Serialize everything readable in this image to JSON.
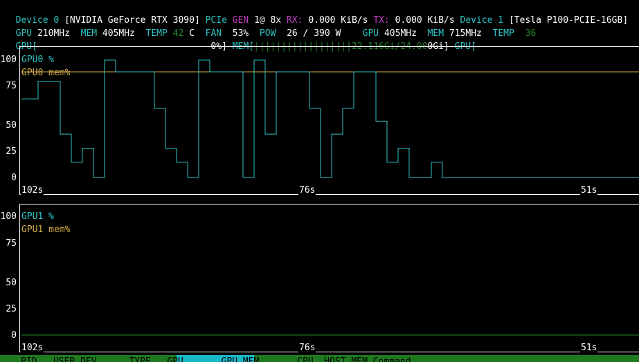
{
  "header": {
    "line1": {
      "dev0_label": "Device 0",
      "dev0_name": "[NVIDIA GeForce RTX 3090]",
      "pcie_label": "PCIe",
      "gen_label": "GEN",
      "gen_value": "1@",
      "width_value": "8x",
      "rx_label": "RX:",
      "rx_value": "0.000 KiB/s",
      "tx_label": "TX:",
      "tx_value": "0.000 KiB/s",
      "dev1_label": "Device 1",
      "dev1_name": "[Tesla P100-PCIE-16GB]"
    },
    "line2": {
      "gpu_label": "GPU",
      "gpu_value": "210MHz",
      "mem_label": "MEM",
      "mem_value": "405MHz",
      "temp_label": "TEMP",
      "temp_value": "42",
      "temp_unit": "C",
      "fan_label": "FAN",
      "fan_value": "53%",
      "pow_label": "POW",
      "pow_value": "26 / 390 W",
      "dev1_gpu_label": "GPU",
      "dev1_gpu_value": "405MHz",
      "dev1_mem_label": "MEM",
      "dev1_mem_value": "715MHz",
      "dev1_temp_label": "TEMP",
      "dev1_temp_value": "36"
    },
    "line3": {
      "gpu_bar_open": "GPU[",
      "gpu_bar_close": "0%]",
      "mem_bar_open": "MEM[",
      "mem_bar_fill": "||||||||||||||||||22.116Gi/24.00",
      "mem_bar_close": "0Gi]",
      "dev1_gpu_bar_open": "GPU["
    }
  },
  "charts": [
    {
      "series1_label": "GPU0 %",
      "series2_label": "GPU0 mem%",
      "yticks": [
        "100",
        "75",
        "50",
        "25",
        "0"
      ],
      "xticks": [
        "102s",
        "76s",
        "51s"
      ]
    },
    {
      "series1_label": "GPU1 %",
      "series2_label": "GPU1 mem%",
      "yticks": [
        "100",
        "75",
        "50",
        "25",
        "0"
      ],
      "xticks": [
        "102s",
        "76s",
        "51s"
      ]
    }
  ],
  "chart_data": [
    {
      "type": "line",
      "ylim": [
        0,
        100
      ],
      "series": [
        {
          "name": "GPU0 %",
          "color": "#2ec4c4",
          "step_values": [
            67,
            67,
            67,
            82,
            82,
            82,
            82,
            37,
            37,
            13,
            13,
            25,
            25,
            0,
            0,
            100,
            100,
            90,
            90,
            90,
            90,
            90,
            90,
            90,
            59,
            59,
            25,
            25,
            13,
            13,
            0,
            0,
            100,
            100,
            90,
            90,
            90,
            90,
            90,
            90,
            0,
            0,
            100,
            100,
            37,
            37,
            90,
            90,
            90,
            90,
            90,
            90,
            59,
            59,
            0,
            0,
            37,
            37,
            59,
            59,
            90,
            90,
            90,
            90,
            48,
            48,
            13,
            13,
            25,
            25,
            0,
            0,
            0,
            0,
            13,
            13,
            0,
            0,
            0,
            0,
            0,
            0,
            0,
            0,
            0,
            0,
            0,
            0,
            0,
            0,
            0,
            0,
            0,
            0,
            0,
            0,
            0,
            0,
            0,
            0,
            0,
            0,
            0,
            0,
            0,
            0,
            0,
            0,
            0,
            0,
            0,
            0
          ]
        },
        {
          "name": "GPU0 mem%",
          "color": "#d6b24a",
          "value": 90
        }
      ]
    },
    {
      "type": "line",
      "ylim": [
        0,
        100
      ],
      "series": [
        {
          "name": "GPU1 %",
          "color": "#2ec4c4",
          "value": 0
        },
        {
          "name": "GPU1 mem%",
          "color": "#d6b24a",
          "value": 0
        }
      ]
    }
  ],
  "footer": {
    "columns": "PID   USER DEV      TYPE   GPU       GPU MEM       CPU  HOST MEM Command"
  }
}
